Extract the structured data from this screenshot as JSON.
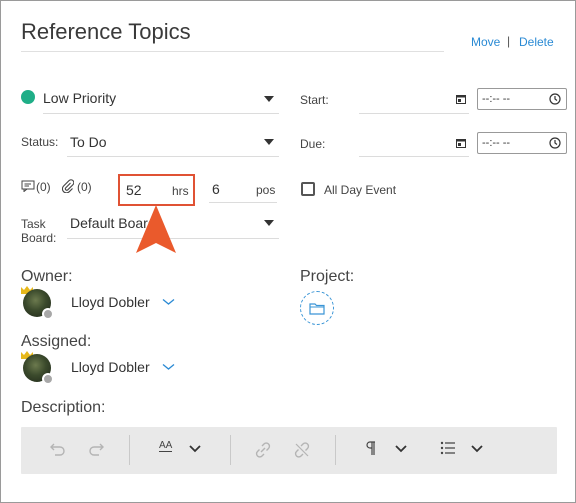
{
  "header": {
    "title": "Reference Topics",
    "move_label": "Move",
    "separator": "|",
    "delete_label": "Delete"
  },
  "priority": {
    "value": "Low Priority",
    "color": "#1fae87"
  },
  "status": {
    "label": "Status:",
    "value": "To Do"
  },
  "start": {
    "label": "Start:",
    "time_placeholder": "--:-- --"
  },
  "due": {
    "label": "Due:",
    "time_placeholder": "--:-- --"
  },
  "counts": {
    "notes": "(0)",
    "attachments": "(0)"
  },
  "hours": {
    "value": "52",
    "unit": "hrs"
  },
  "position": {
    "value": "6",
    "unit": "pos"
  },
  "all_day": {
    "label": "All Day Event",
    "checked": false
  },
  "task_board": {
    "label_line1": "Task",
    "label_line2": "Board:",
    "value": "Default Board"
  },
  "owner": {
    "label": "Owner:",
    "name": "Lloyd Dobler"
  },
  "project": {
    "label": "Project:"
  },
  "assigned": {
    "label": "Assigned:",
    "name": "Lloyd Dobler"
  },
  "description": {
    "label": "Description:"
  },
  "toolbar": {
    "font_size_label": "AA",
    "icons": [
      "undo-icon",
      "redo-icon",
      "font-size-icon",
      "link-icon",
      "unlink-icon",
      "paragraph-icon",
      "list-icon"
    ]
  },
  "colors": {
    "accent": "#2a8ad4",
    "highlight": "#e05234",
    "arrow": "#ea5a2c"
  }
}
